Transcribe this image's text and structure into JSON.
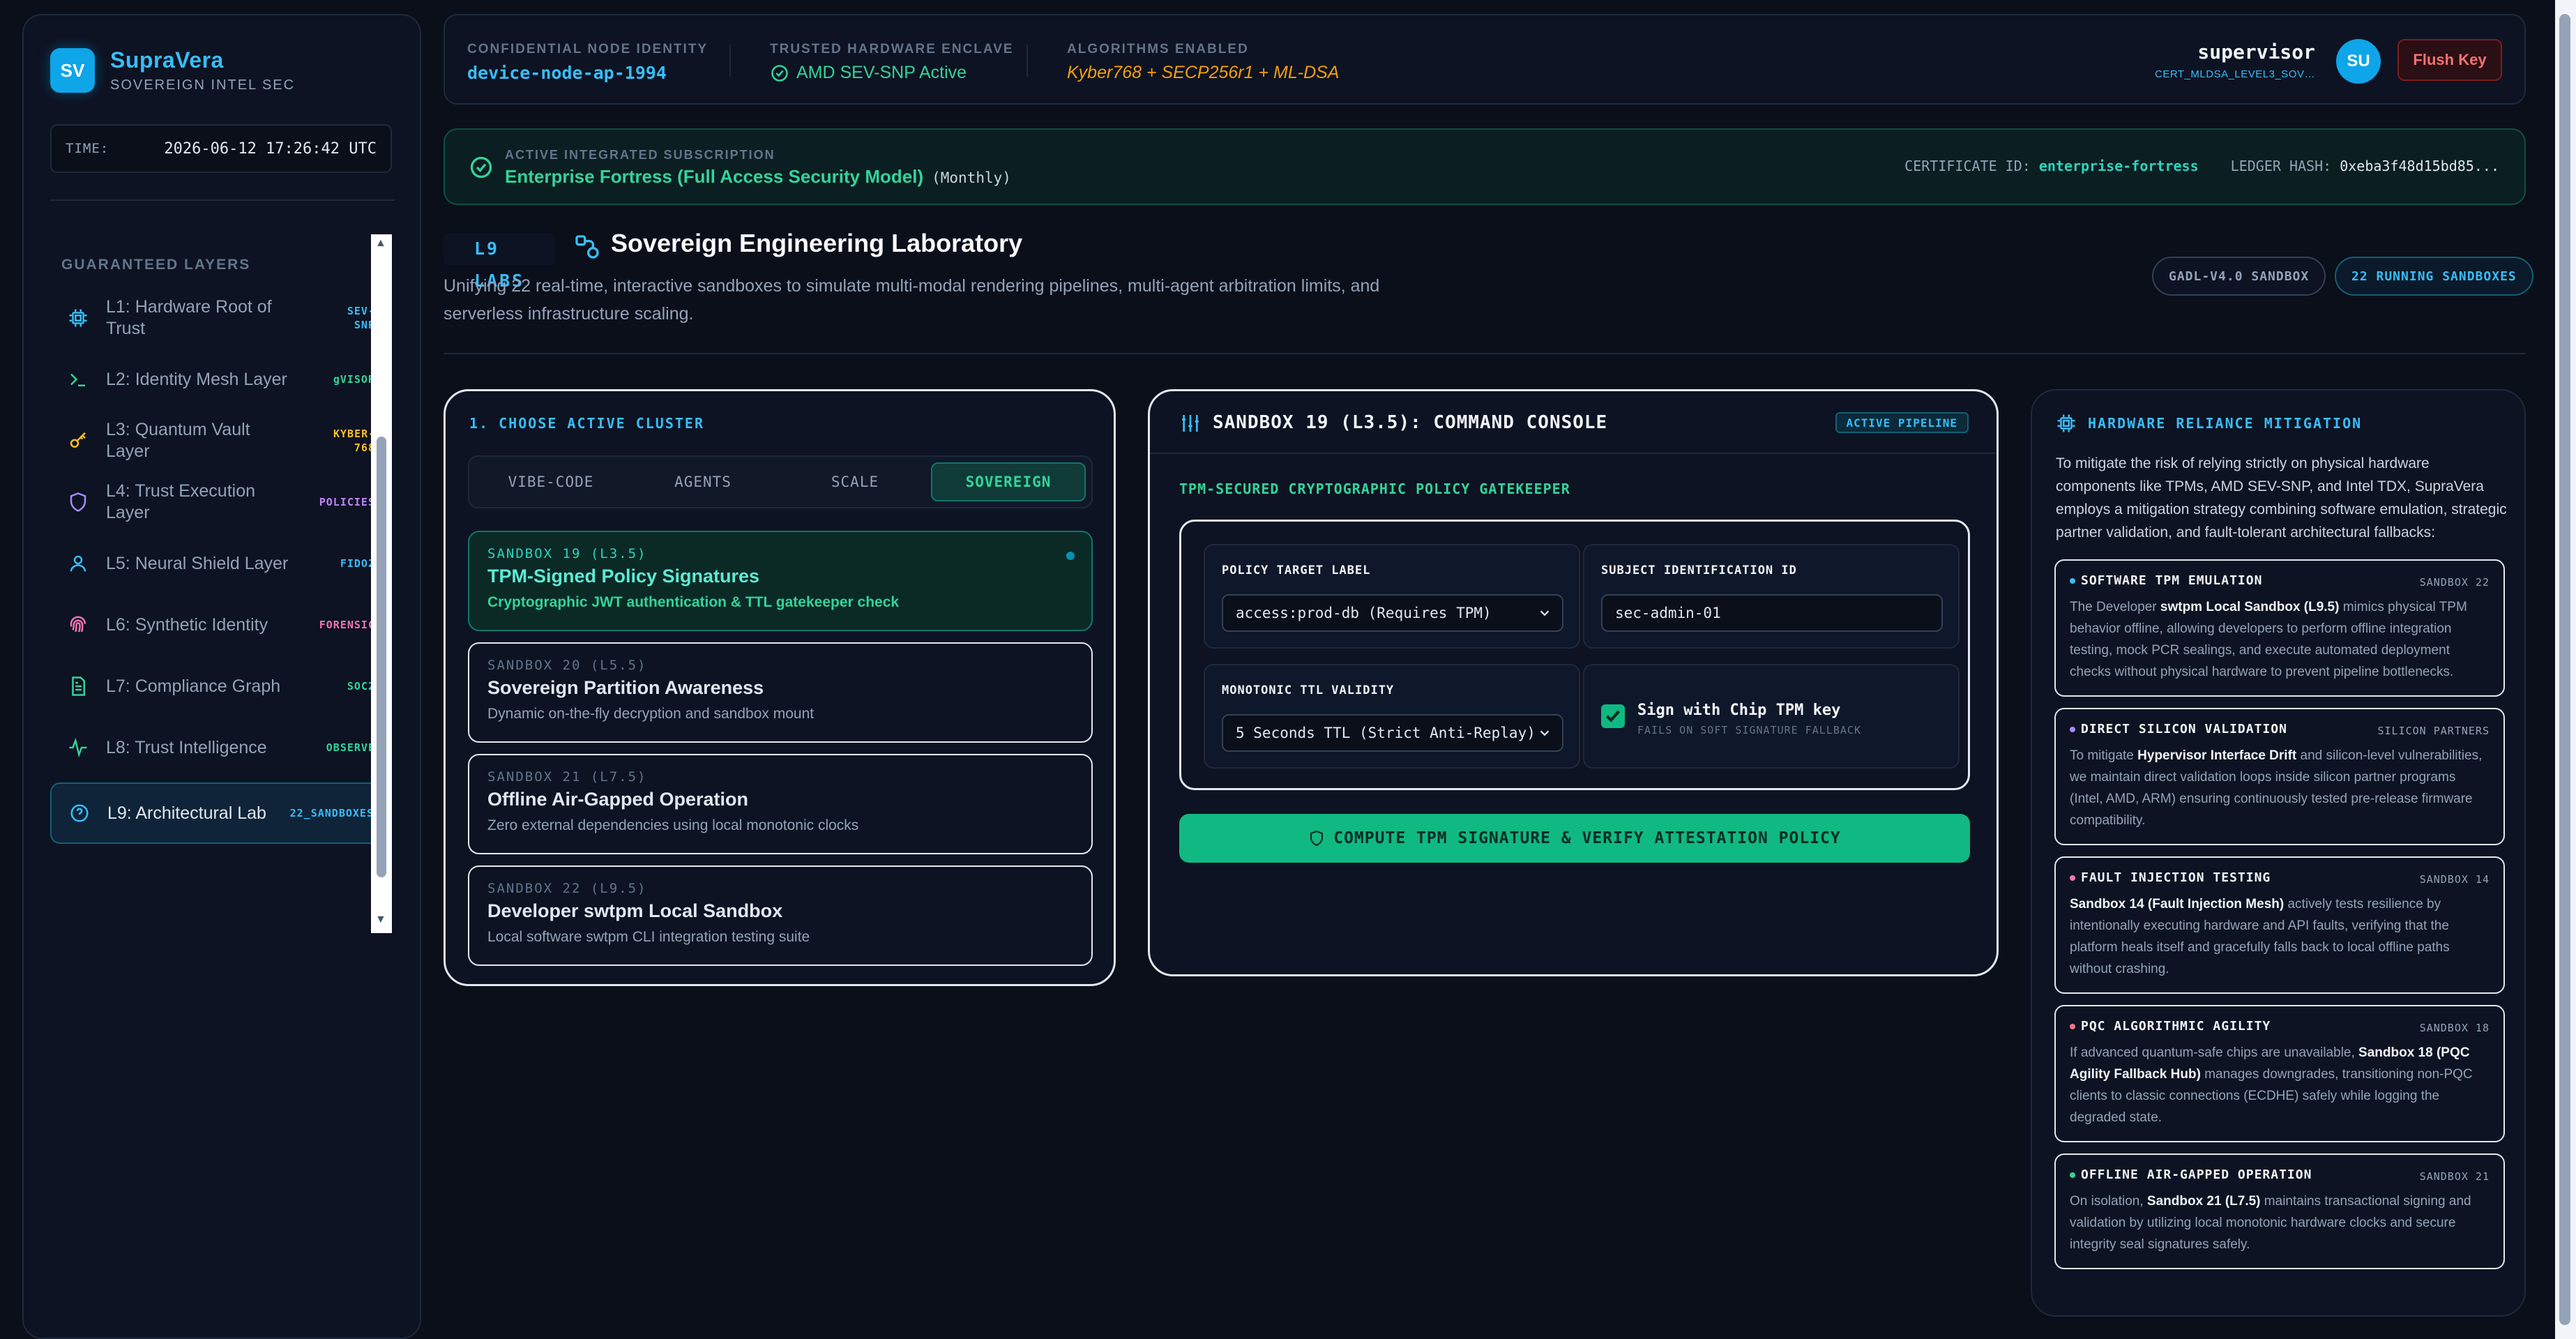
{
  "brand": {
    "logo": "SV",
    "name": "SupraVera",
    "subtitle": "SOVEREIGN INTEL SEC"
  },
  "clock": {
    "label": "TIME:",
    "value": "2026-06-12 17:26:42 UTC"
  },
  "sidebar": {
    "section_title": "GUARANTEED LAYERS",
    "items": [
      {
        "label": "L1: Hardware Root of Trust",
        "badge": "SEV-SNP",
        "badge_color": "#38bdf8",
        "icon": "chip-icon"
      },
      {
        "label": "L2: Identity Mesh Layer",
        "badge": "gVISOR",
        "badge_color": "#34d399",
        "icon": "terminal-icon"
      },
      {
        "label": "L3: Quantum Vault Layer",
        "badge": "KYBER-768",
        "badge_color": "#fbbf24",
        "icon": "key-icon"
      },
      {
        "label": "L4: Trust Execution Layer",
        "badge": "POLICIES",
        "badge_color": "#c084fc",
        "icon": "shield-icon"
      },
      {
        "label": "L5: Neural Shield Layer",
        "badge": "FIDO2",
        "badge_color": "#38bdf8",
        "icon": "user-icon"
      },
      {
        "label": "L6: Synthetic Identity",
        "badge": "FORENSIC",
        "badge_color": "#f472b6",
        "icon": "fingerprint-icon"
      },
      {
        "label": "L7: Compliance Graph",
        "badge": "SOC2",
        "badge_color": "#34d399",
        "icon": "document-icon"
      },
      {
        "label": "L8: Trust Intelligence",
        "badge": "OBSERVE",
        "badge_color": "#34d399",
        "icon": "activity-icon"
      },
      {
        "label": "L9: Architectural Lab",
        "badge": "22_SANDBOXES",
        "badge_color": "#38bdf8",
        "icon": "help-circle-icon"
      }
    ]
  },
  "header": {
    "node_label": "CONFIDENTIAL NODE IDENTITY",
    "node_value": "device-node-ap-1994",
    "enclave_label": "TRUSTED HARDWARE ENCLAVE",
    "enclave_value": "AMD SEV-SNP Active",
    "algo_label": "ALGORITHMS ENABLED",
    "algo_value": "Kyber768 + SECP256r1 + ML-DSA",
    "user_name": "supervisor",
    "user_cert": "CERT_MLDSA_LEVEL3_SOV…",
    "avatar": "SU",
    "flush_label": "Flush Key"
  },
  "subscription": {
    "label": "ACTIVE INTEGRATED SUBSCRIPTION",
    "name": "Enterprise Fortress (Full Access Security Model)",
    "period": "(Monthly)",
    "cert_label": "CERTIFICATE ID:",
    "cert_value": "enterprise-fortress",
    "ledger_label": "LEDGER HASH:",
    "ledger_value": "0xeba3f48d15bd85..."
  },
  "lab": {
    "tag": "L9 LABS",
    "title": "Sovereign Engineering Laboratory",
    "description": "Unifying 22 real-time, interactive sandboxes to simulate multi-modal rendering pipelines, multi-agent arbitration limits, and serverless infrastructure scaling.",
    "pill_sandbox": "GADL-V4.0 SANDBOX",
    "pill_running": "22 RUNNING SANDBOXES"
  },
  "cluster": {
    "title": "1. CHOOSE ACTIVE CLUSTER",
    "tabs": [
      "VIBE-CODE",
      "AGENTS",
      "SCALE",
      "SOVEREIGN"
    ],
    "active_tab": "SOVEREIGN",
    "sandboxes": [
      {
        "id": "SANDBOX 19 (L3.5)",
        "name": "TPM-Signed Policy Signatures",
        "desc": "Cryptographic JWT authentication & TTL gatekeeper check",
        "selected": true
      },
      {
        "id": "SANDBOX 20 (L5.5)",
        "name": "Sovereign Partition Awareness",
        "desc": "Dynamic on-the-fly decryption and sandbox mount",
        "selected": false
      },
      {
        "id": "SANDBOX 21 (L7.5)",
        "name": "Offline Air-Gapped Operation",
        "desc": "Zero external dependencies using local monotonic clocks",
        "selected": false
      },
      {
        "id": "SANDBOX 22 (L9.5)",
        "name": "Developer swtpm Local Sandbox",
        "desc": "Local software swtpm CLI integration testing suite",
        "selected": false
      }
    ]
  },
  "console": {
    "title": "SANDBOX 19 (L3.5): COMMAND CONSOLE",
    "badge": "ACTIVE PIPELINE",
    "gate_title": "TPM-SECURED CRYPTOGRAPHIC POLICY GATEKEEPER",
    "policy_label": "POLICY TARGET LABEL",
    "policy_value": "access:prod-db (Requires TPM)",
    "subject_label": "SUBJECT IDENTIFICATION ID",
    "subject_value": "sec-admin-01",
    "ttl_label": "MONOTONIC TTL VALIDITY",
    "ttl_value": "5 Seconds TTL (Strict Anti-Replay)",
    "sign_label": "Sign with Chip TPM key",
    "sign_sub": "FAILS ON SOFT SIGNATURE FALLBACK",
    "compute_label": "COMPUTE TPM SIGNATURE & VERIFY ATTESTATION POLICY"
  },
  "mitigation": {
    "title": "HARDWARE RELIANCE MITIGATION",
    "intro": "To mitigate the risk of relying strictly on physical hardware components like TPMs, AMD SEV-SNP, and Intel TDX, SupraVera employs a mitigation strategy combining software emulation, strategic partner validation, and fault-tolerant architectural fallbacks:",
    "cards": [
      {
        "title": "SOFTWARE TPM EMULATION",
        "tag": "SANDBOX 22",
        "dot": "#38bdf8",
        "pre": "The Developer ",
        "bold": "swtpm Local Sandbox (L9.5)",
        "post": " mimics physical TPM behavior offline, allowing developers to perform offline integration testing, mock PCR sealings, and execute automated deployment checks without physical hardware to prevent pipeline bottlenecks."
      },
      {
        "title": "DIRECT SILICON VALIDATION",
        "tag": "SILICON PARTNERS",
        "dot": "#a78bfa",
        "pre": "To mitigate ",
        "bold": "Hypervisor Interface Drift",
        "post": " and silicon-level vulnerabilities, we maintain direct validation loops inside silicon partner programs (Intel, AMD, ARM) ensuring continuously tested pre-release firmware compatibility."
      },
      {
        "title": "FAULT INJECTION TESTING",
        "tag": "SANDBOX 14",
        "dot": "#f472b6",
        "pre": "",
        "bold": "Sandbox 14 (Fault Injection Mesh)",
        "post": " actively tests resilience by intentionally executing hardware and API faults, verifying that the platform heals itself and gracefully falls back to local offline paths without crashing."
      },
      {
        "title": "PQC ALGORITHMIC AGILITY",
        "tag": "SANDBOX 18",
        "dot": "#fb7185",
        "pre": "If advanced quantum-safe chips are unavailable, ",
        "bold": "Sandbox 18 (PQC Agility Fallback Hub)",
        "post": " manages downgrades, transitioning non-PQC clients to classic connections (ECDHE) safely while logging the degraded state."
      },
      {
        "title": "OFFLINE AIR-GAPPED OPERATION",
        "tag": "SANDBOX 21",
        "dot": "#34d399",
        "pre": "On isolation, ",
        "bold": "Sandbox 21 (L7.5)",
        "post": " maintains transactional signing and validation by utilizing local monotonic hardware clocks and secure integrity seal signatures safely."
      }
    ]
  }
}
